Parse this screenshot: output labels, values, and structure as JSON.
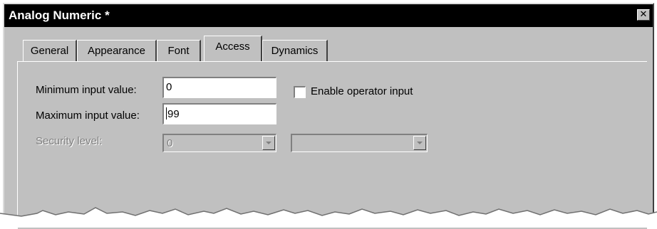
{
  "window": {
    "title": "Analog Numeric *",
    "close_glyph": "✕"
  },
  "tabs": [
    {
      "label": "General",
      "active": false
    },
    {
      "label": "Appearance",
      "active": false
    },
    {
      "label": "Font",
      "active": false
    },
    {
      "label": "Access",
      "active": true
    },
    {
      "label": "Dynamics",
      "active": false
    }
  ],
  "form": {
    "min_label": "Minimum input value:",
    "min_value": "0",
    "max_label": "Maximum input value:",
    "max_value": "99",
    "enable_label": "Enable operator input",
    "enable_checked": false,
    "security_label": "Security level:",
    "security_value": "0",
    "security_second_value": ""
  },
  "colors": {
    "face": "#c0c0c0",
    "titlebar": "#000000",
    "disabled_text": "#808080"
  }
}
